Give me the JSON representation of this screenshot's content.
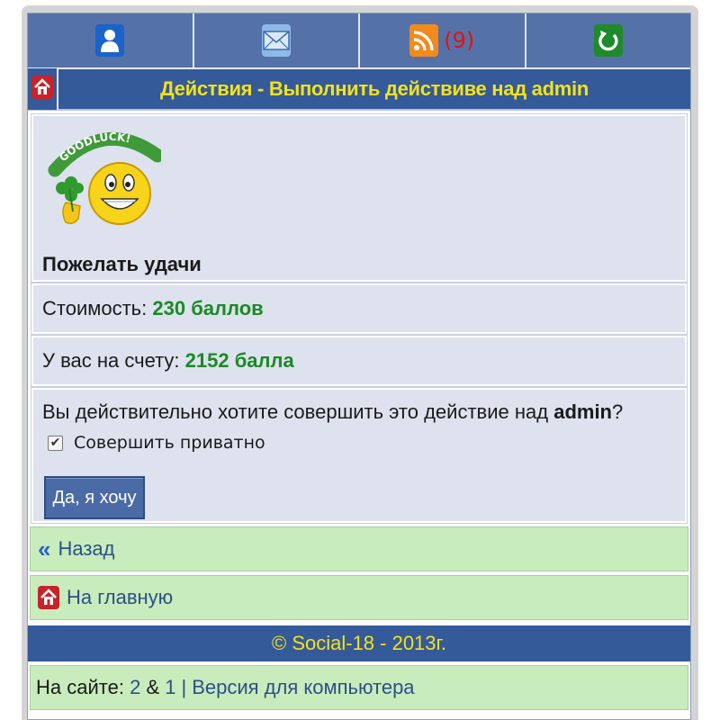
{
  "nav": {
    "items": [
      {
        "icon": "user-icon"
      },
      {
        "icon": "mail-icon"
      },
      {
        "icon": "rss-icon",
        "count": "(9)"
      },
      {
        "icon": "refresh-icon"
      }
    ]
  },
  "header": {
    "title": "Действия - Выполнить действиве над admin"
  },
  "item": {
    "image_text": "GOODLUCK!",
    "name": "Пожелать удачи"
  },
  "cost": {
    "label": "Стоимость:",
    "value": "230 баллов"
  },
  "balance": {
    "label": "У вас на счету:",
    "value": "2152 балла"
  },
  "confirm": {
    "question_prefix": "Вы действительно хотите совершить это действие над",
    "target": "admin",
    "question_suffix": "?",
    "private_label": "Совершить приватно",
    "private_checked": true,
    "submit_label": "Да, я хочу"
  },
  "links": {
    "back_arrows": "«",
    "back_label": "Назад",
    "home_label": "На главную"
  },
  "footer": {
    "copyright": "© Social-18 - 2013г."
  },
  "online": {
    "label": "На сайте:",
    "count_a": "2",
    "amp": "&",
    "count_b": "1",
    "separator": "|",
    "desktop_link": "Версия для компьютера"
  },
  "colors": {
    "nav_bg": "#5472a8",
    "title_bg": "#355a99",
    "title_text": "#f3e21c",
    "block_bg": "#dde2ee",
    "green_value": "#1b8a25",
    "link_block_bg": "#c8ecbb",
    "badge_red": "#e81010"
  }
}
